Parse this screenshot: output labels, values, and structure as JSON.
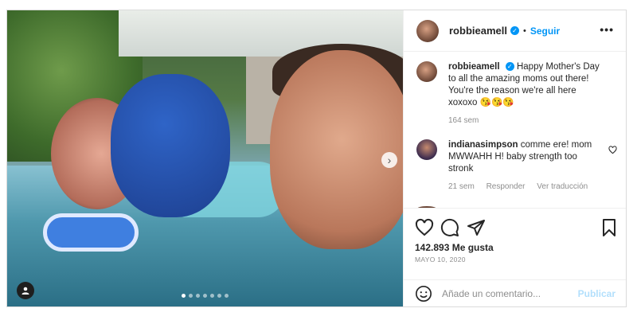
{
  "post": {
    "username": "robbieamell",
    "follow_label": "Seguir",
    "separator": "•",
    "more_label": "•••",
    "caption": "Happy Mother's Day to all the amazing moms out there! You're the reason we're all here xoxoxo 😘😘😘",
    "caption_age": "164 sem",
    "likes": "142.893 Me gusta",
    "date": "MAYO 10, 2020",
    "carousel_count": 7,
    "carousel_active": 1,
    "next_arrow": "›"
  },
  "comments": [
    {
      "username": "indianasimpson",
      "text": "comme ere! mom MWWAHH H! baby strength too stronk",
      "age": "21 sem",
      "reply_label": "Responder",
      "translate_label": "Ver traducción"
    }
  ],
  "composer": {
    "placeholder": "Añade un comentario...",
    "post_label": "Publicar"
  },
  "colors": {
    "accent": "#0095f6",
    "post_disabled": "#b2dffc",
    "muted": "#8e8e8e"
  },
  "icons": [
    "heart-icon",
    "comment-icon",
    "share-icon",
    "bookmark-icon",
    "emoji-icon",
    "user-tag-icon",
    "verified-icon",
    "more-options-icon",
    "chevron-right-icon"
  ]
}
